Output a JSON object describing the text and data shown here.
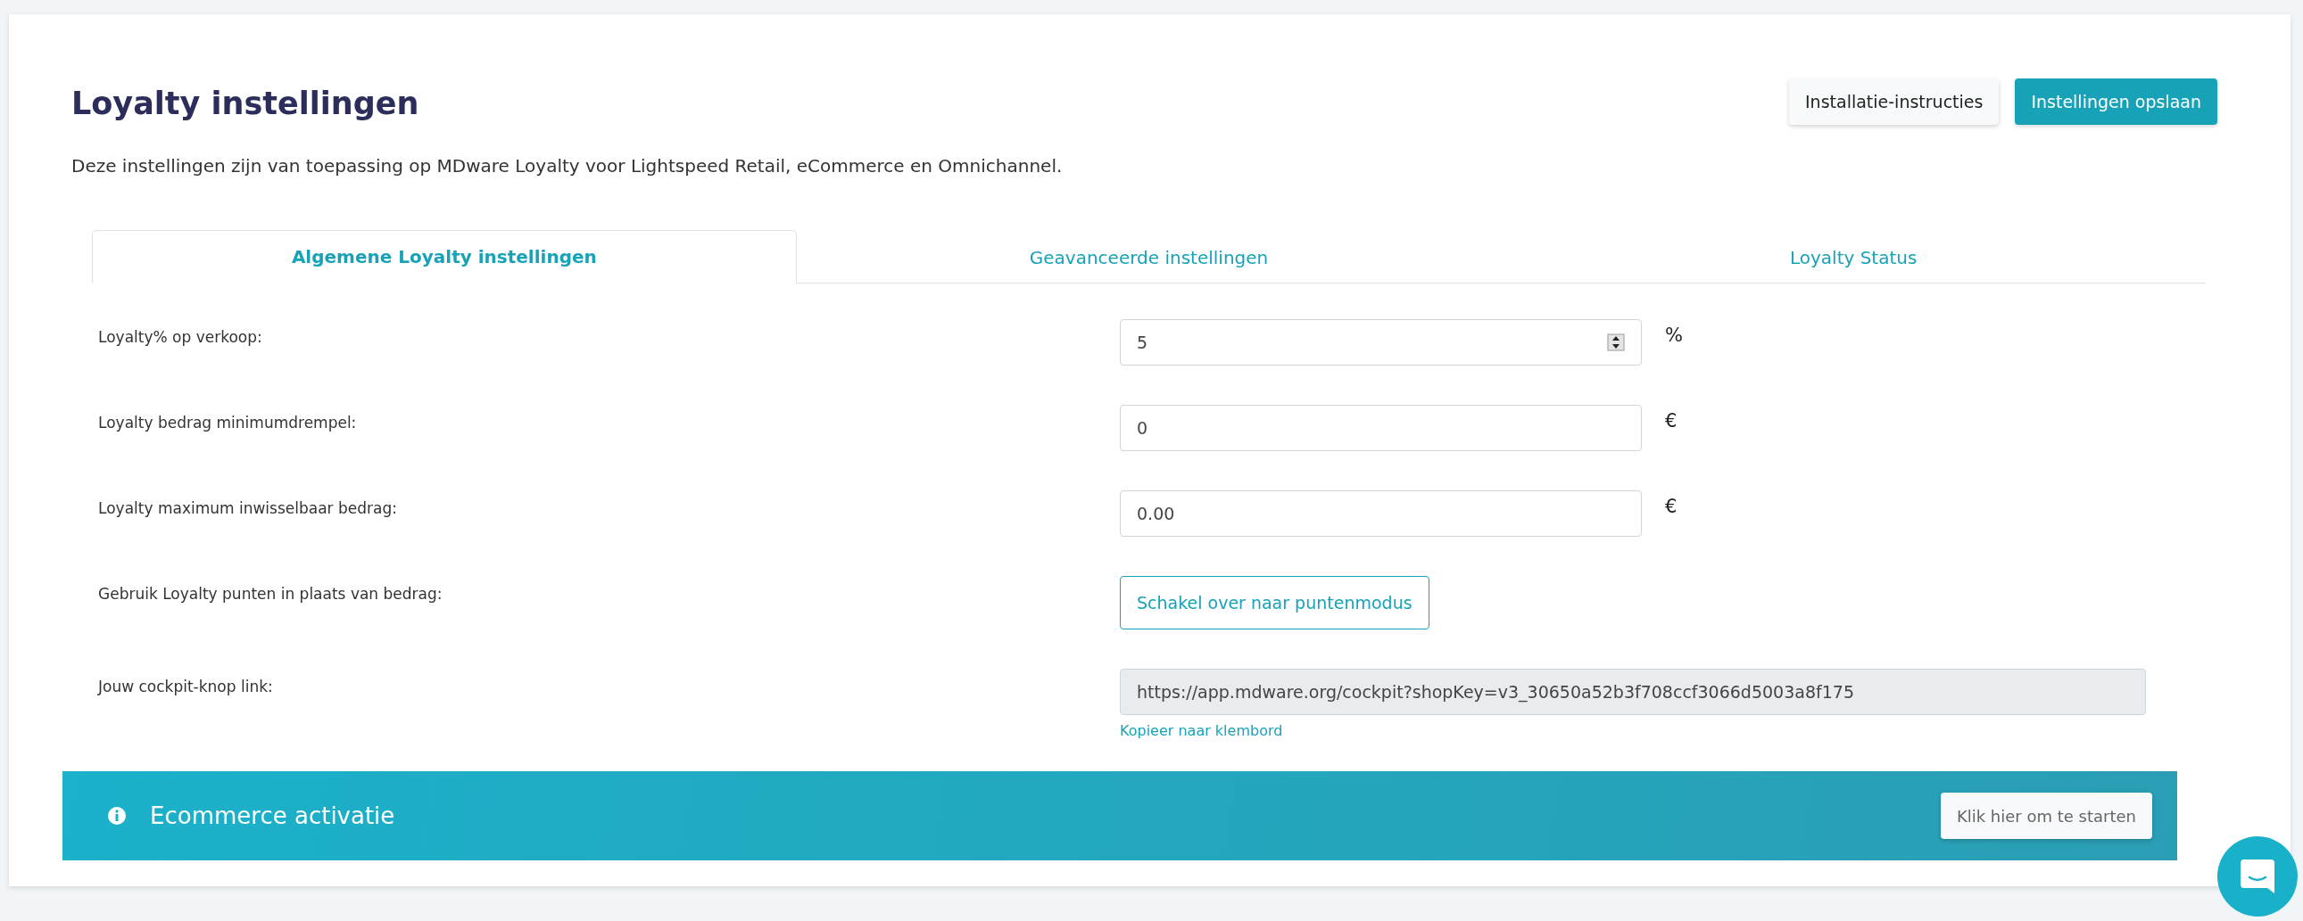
{
  "header": {
    "title": "Loyalty instellingen",
    "description": "Deze instellingen zijn van toepassing op MDware Loyalty voor Lightspeed Retail, eCommerce en Omnichannel.",
    "buttons": [
      {
        "label": "Installatie-instructies",
        "kind": "secondary"
      },
      {
        "label": "Instellingen opslaan",
        "kind": "primary"
      }
    ]
  },
  "tabs": [
    {
      "label": "Algemene Loyalty instellingen",
      "selected": true
    },
    {
      "label": "Geavanceerde instellingen",
      "selected": false
    },
    {
      "label": "Loyalty Status",
      "selected": false
    }
  ],
  "fields": [
    {
      "kind": "number",
      "label": "Loyalty% op verkoop:",
      "value": "5",
      "suffix": "%"
    },
    {
      "kind": "text",
      "label": "Loyalty bedrag minimumdrempel:",
      "value": "0",
      "suffix": "€"
    },
    {
      "kind": "text",
      "label": "Loyalty maximum inwisselbaar bedrag:",
      "value": "0.00",
      "suffix": "€"
    },
    {
      "kind": "button",
      "label": "Gebruik Loyalty punten in plaats van bedrag:",
      "button": "Schakel over naar puntenmodus"
    },
    {
      "kind": "link",
      "label": "Jouw cockpit-knop link:",
      "value": "https://app.mdware.org/cockpit?shopKey=v3_30650a52b3f708ccf3066d5003a8f175",
      "link": "Kopieer naar klembord"
    }
  ],
  "banner": {
    "title": "Ecommerce activatie",
    "button": "Klik hier om te starten"
  }
}
